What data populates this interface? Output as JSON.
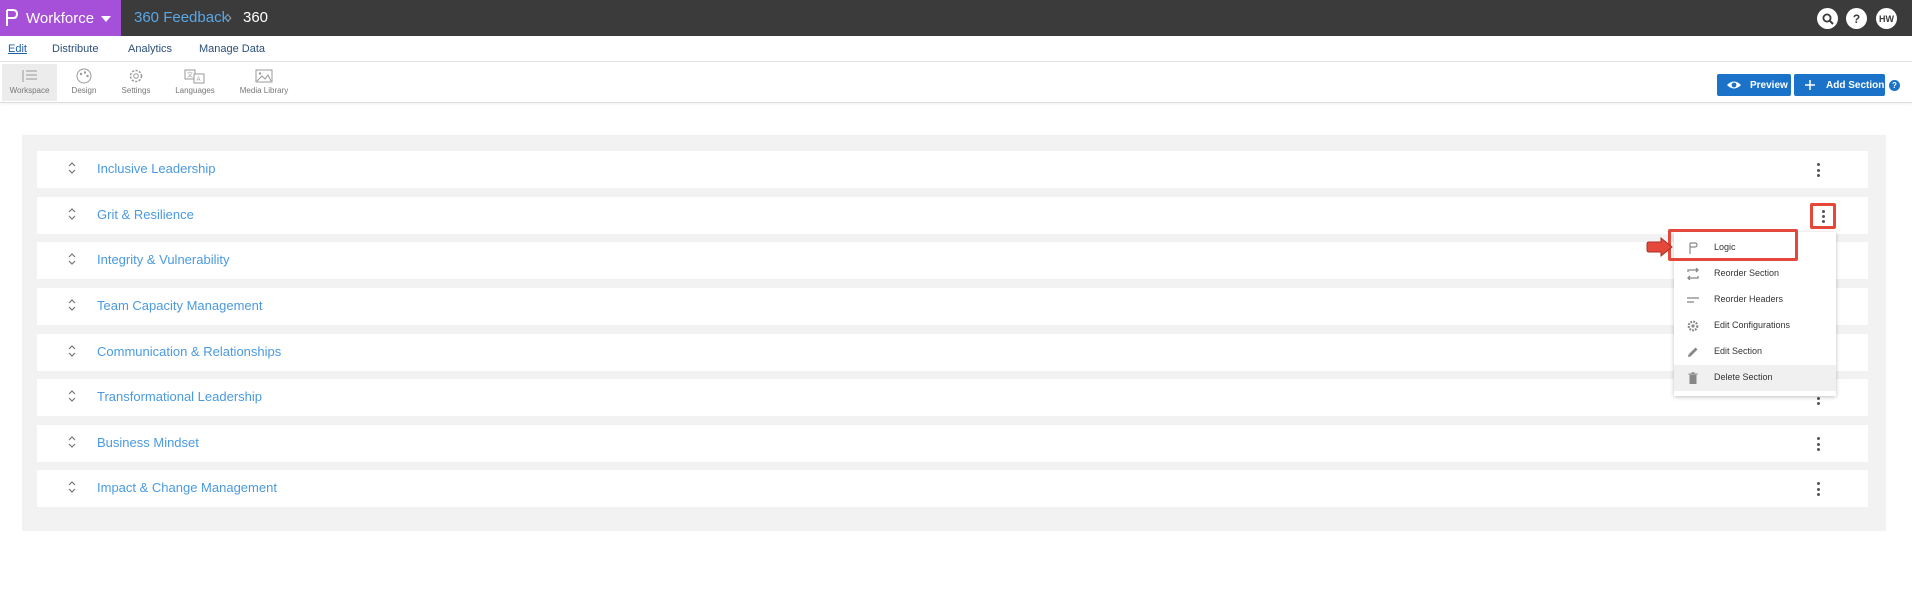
{
  "topbar": {
    "brand": "Workforce",
    "breadcrumb": [
      "360 Feedback",
      "360"
    ],
    "breadcrumb_sep": "›",
    "search_icon": "search-icon",
    "help_label": "?",
    "avatar": "HW",
    "brand_color": "#a64fd8"
  },
  "menu": {
    "items": [
      "Edit",
      "Distribute",
      "Analytics",
      "Manage Data"
    ],
    "active": "Edit"
  },
  "toolbar": {
    "tools": [
      {
        "label": "Workspace",
        "icon": "list-icon"
      },
      {
        "label": "Design",
        "icon": "palette-icon"
      },
      {
        "label": "Settings",
        "icon": "gear-icon"
      },
      {
        "label": "Languages",
        "icon": "translate-icon"
      },
      {
        "label": "Media Library",
        "icon": "image-icon"
      }
    ],
    "preview_label": "Preview",
    "add_section_label": "Add Section",
    "help_label": "?",
    "accent": "#1a73c8"
  },
  "sections": [
    {
      "title": "Inclusive Leadership"
    },
    {
      "title": "Grit & Resilience"
    },
    {
      "title": "Integrity & Vulnerability"
    },
    {
      "title": "Team Capacity Management"
    },
    {
      "title": "Communication & Relationships"
    },
    {
      "title": "Transformational Leadership"
    },
    {
      "title": "Business Mindset"
    },
    {
      "title": "Impact & Change Management"
    }
  ],
  "dropdown": {
    "items": [
      {
        "label": "Logic",
        "icon": "flag-icon"
      },
      {
        "label": "Reorder Section",
        "icon": "reorder-icon"
      },
      {
        "label": "Reorder Headers",
        "icon": "lines-icon"
      },
      {
        "label": "Edit Configurations",
        "icon": "gear-icon"
      },
      {
        "label": "Edit Section",
        "icon": "pencil-icon"
      },
      {
        "label": "Delete Section",
        "icon": "trash-icon"
      }
    ],
    "highlight_color": "#e5483b"
  }
}
